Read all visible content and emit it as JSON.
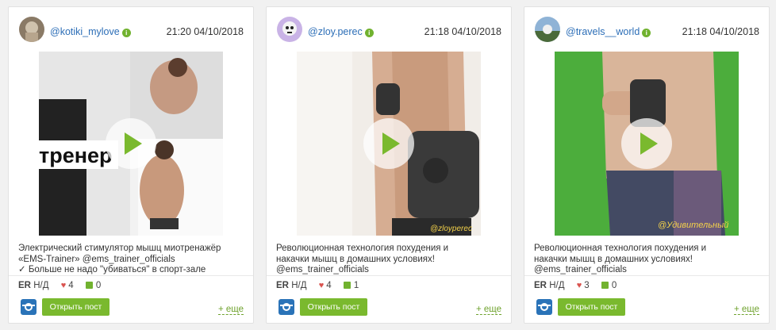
{
  "posts": [
    {
      "username": "@kotiki_mylove",
      "datetime": "21:20 04/10/2018",
      "verified_icon": "verified-icon",
      "media_overlay_text": "тренер",
      "caption": [
        "Электрический стимулятор мышц миотренажёр",
        "«EMS-Trainer» @ems_trainer_officials",
        "✓ Больше не надо \"убиваться\" в спорт-зале"
      ],
      "er_label": "ER",
      "er_value": "Н/Д",
      "likes": "4",
      "comments": "0",
      "open_label": "Открыть пост",
      "more_label": "+ еще"
    },
    {
      "username": "@zloy.perec",
      "datetime": "21:18 04/10/2018",
      "verified_icon": "verified-icon",
      "media_overlay_text": "@zloyperec",
      "caption": [
        "Революционная технология похудения и",
        "накачки мышц в домашних условиях!",
        "@ems_trainer_officials"
      ],
      "er_label": "ER",
      "er_value": "Н/Д",
      "likes": "4",
      "comments": "1",
      "open_label": "Открыть пост",
      "more_label": "+ еще"
    },
    {
      "username": "@travels__world",
      "datetime": "21:18 04/10/2018",
      "verified_icon": "verified-icon",
      "media_overlay_text": "@Удивительный",
      "caption": [
        "Революционная технология похудения и",
        "накачки мышц в домашних условиях!",
        "@ems_trainer_officials"
      ],
      "er_label": "ER",
      "er_value": "Н/Д",
      "likes": "3",
      "comments": "0",
      "open_label": "Открыть пост",
      "more_label": "+ еще"
    }
  ],
  "colors": {
    "accent_green": "#7ab92e",
    "link_blue": "#2c6eb7",
    "heart_red": "#d9534f",
    "instagram_blue": "#2a73b8"
  }
}
